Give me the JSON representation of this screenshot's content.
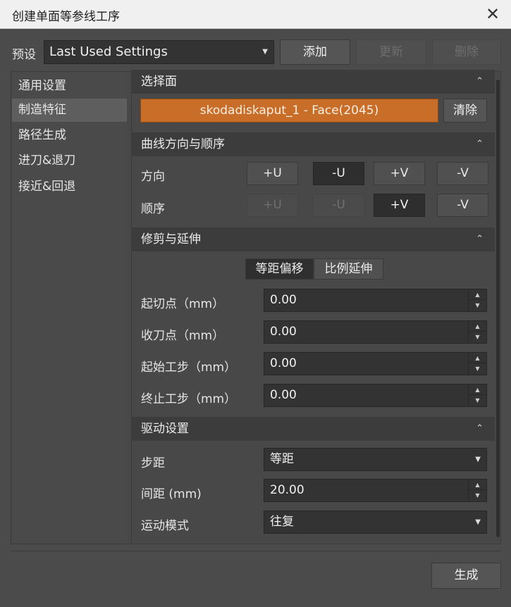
{
  "window": {
    "title": "创建单面等参线工序",
    "close_icon": "✕"
  },
  "preset": {
    "label": "预设",
    "selected": "Last Used Settings",
    "add": "添加",
    "update": "更新",
    "delete": "删除"
  },
  "sidebar": {
    "items": [
      {
        "label": "通用设置",
        "active": false
      },
      {
        "label": "制造特征",
        "active": true
      },
      {
        "label": "路径生成",
        "active": false
      },
      {
        "label": "进刀&退刀",
        "active": false
      },
      {
        "label": "接近&回退",
        "active": false
      }
    ]
  },
  "sections": {
    "select_face": {
      "title": "选择面",
      "face": "skodadiskaput_1 - Face(2045)",
      "clear": "清除"
    },
    "curve": {
      "title": "曲线方向与顺序",
      "direction_label": "方向",
      "order_label": "顺序",
      "direction": [
        "+U",
        "-U",
        "+V",
        "-V"
      ],
      "order": [
        "+U",
        "-U",
        "+V",
        "-V"
      ]
    },
    "trim": {
      "title": "修剪与延伸",
      "mode_offset": "等距偏移",
      "mode_ratio": "比例延伸",
      "start_cut_label": "起切点（mm）",
      "start_cut": "0.00",
      "end_cut_label": "收刀点（mm）",
      "end_cut": "0.00",
      "start_step_label": "起始工步（mm）",
      "start_step": "0.00",
      "end_step_label": "终止工步（mm）",
      "end_step": "0.00"
    },
    "drive": {
      "title": "驱动设置",
      "stepover_label": "步距",
      "stepover": "等距",
      "spacing_label": "间距 (mm)",
      "spacing": "20.00",
      "motion_label": "运动模式",
      "motion": "往复"
    }
  },
  "footer": {
    "generate": "生成"
  },
  "colors": {
    "accent": "#c86e28"
  }
}
